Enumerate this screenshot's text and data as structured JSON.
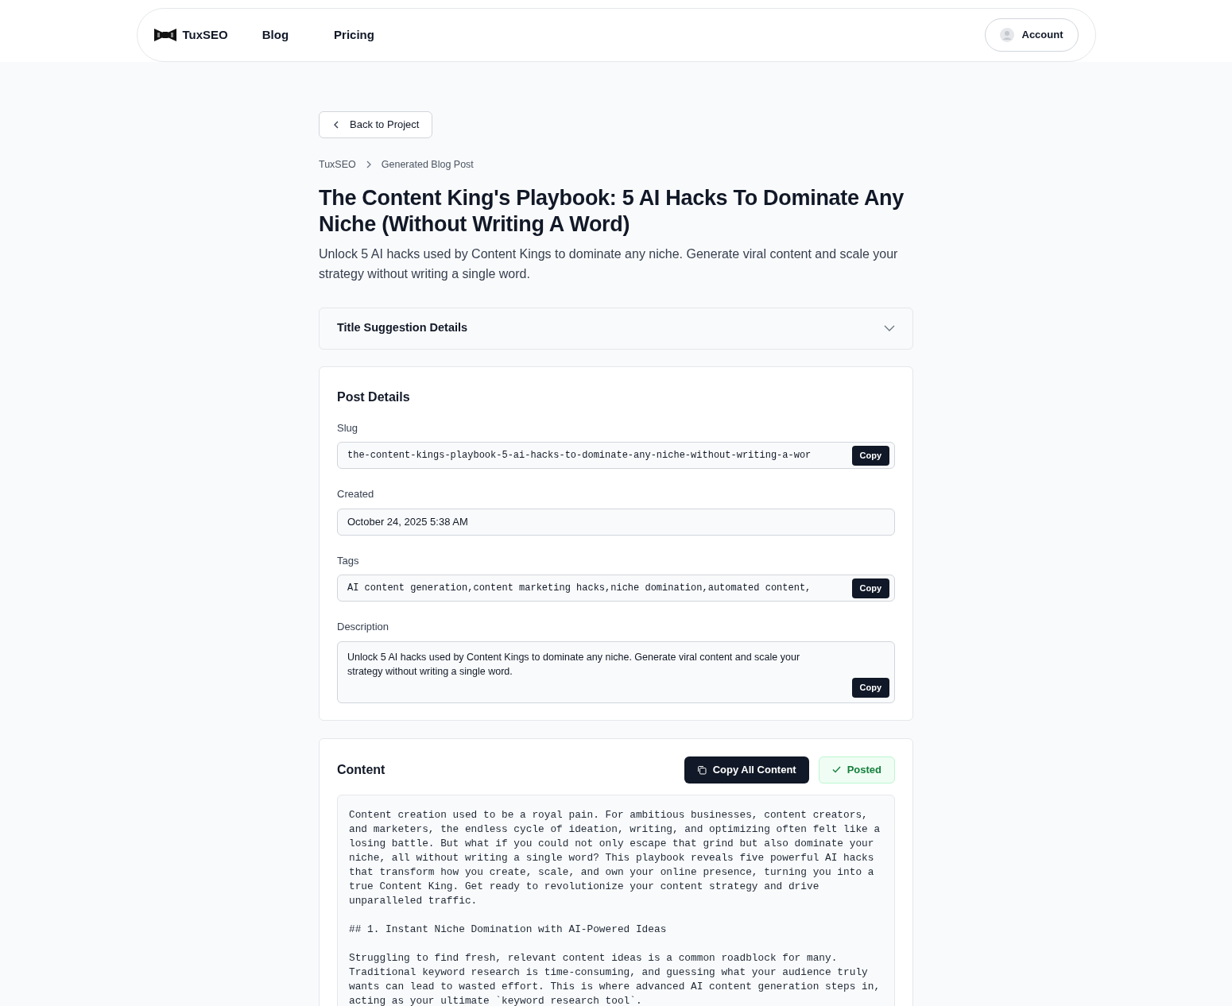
{
  "nav": {
    "brand": "TuxSEO",
    "links": [
      "Blog",
      "Pricing"
    ],
    "account": "Account"
  },
  "back_button": "Back to Project",
  "breadcrumbs": [
    "TuxSEO",
    "Generated Blog Post"
  ],
  "title": "The Content King's Playbook: 5 AI Hacks To Dominate Any Niche (Without Writing A Word)",
  "subtitle": "Unlock 5 AI hacks used by Content Kings to dominate any niche. Generate viral content and scale your strategy without writing a single word.",
  "title_suggestion": {
    "label": "Title Suggestion Details",
    "expanded": false
  },
  "post_details": {
    "heading": "Post Details",
    "fields": [
      {
        "label": "Slug",
        "kind": "mono",
        "value": "the-content-kings-playbook-5-ai-hacks-to-dominate-any-niche-without-writing-a-wor",
        "copy": "Copy"
      },
      {
        "label": "Created",
        "kind": "plain",
        "value": "October 24, 2025 5:38 AM"
      },
      {
        "label": "Tags",
        "kind": "mono",
        "value": "AI content generation,content marketing hacks,niche domination,automated content,",
        "copy": "Copy"
      },
      {
        "label": "Description",
        "kind": "textarea",
        "value": "Unlock 5 AI hacks used by Content Kings to dominate any niche. Generate viral content and scale your strategy without writing a single word.",
        "copy": "Copy"
      }
    ]
  },
  "content": {
    "heading": "Content",
    "copy_all": "Copy All Content",
    "status": {
      "label": "Posted",
      "posted": true
    },
    "text": "Content creation used to be a royal pain. For ambitious businesses, content creators,\nand marketers, the endless cycle of ideation, writing, and optimizing often felt like a\nlosing battle. But what if you could not only escape that grind but also dominate your\nniche, all without writing a single word? This playbook reveals five powerful AI hacks\nthat transform how you create, scale, and own your online presence, turning you into a\ntrue Content King. Get ready to revolutionize your content strategy and drive\nunparalleled traffic.\n\n## 1. Instant Niche Domination with AI-Powered Ideas\n\nStruggling to find fresh, relevant content ideas is a common roadblock for many.\nTraditional keyword research is time-consuming, and guessing what your audience truly\nwants can lead to wasted effort. This is where advanced AI content generation steps in,\nacting as your ultimate `keyword research tool`."
  }
}
